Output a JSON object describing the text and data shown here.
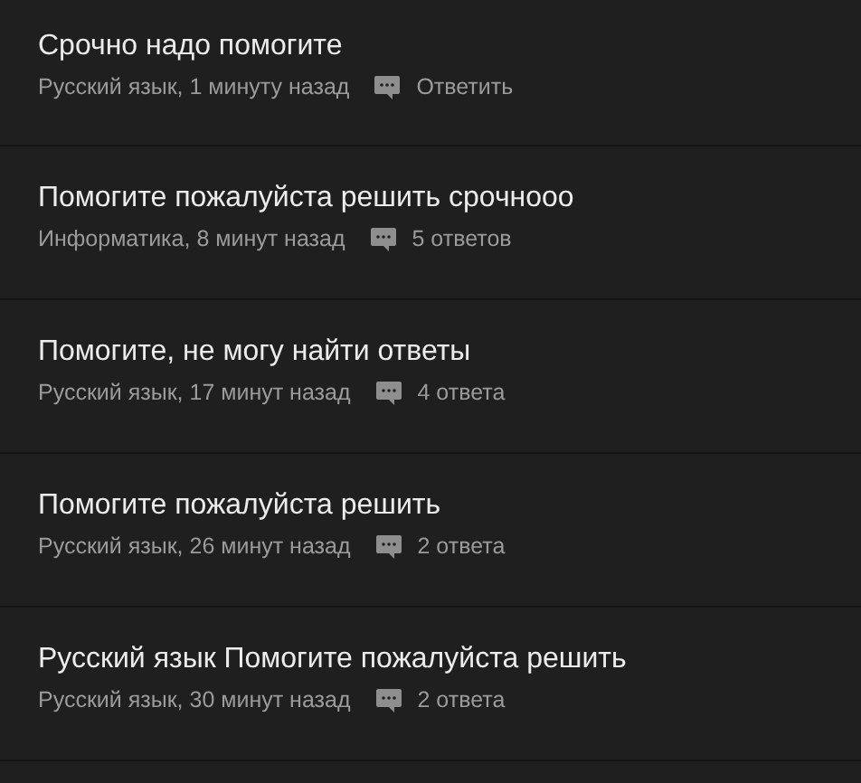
{
  "questions": [
    {
      "title": "Срочно надо помогите",
      "meta": "Русский язык, 1 минуту назад",
      "answers": "Ответить"
    },
    {
      "title": "Помогите пожалуйста решить срочнооо",
      "meta": "Информатика, 8 минут назад",
      "answers": "5 ответов"
    },
    {
      "title": "Помогите, не могу найти ответы",
      "meta": "Русский язык, 17 минут назад",
      "answers": "4 ответа"
    },
    {
      "title": "Помогите пожалуйста решить",
      "meta": "Русский язык, 26 минут назад",
      "answers": "2 ответа"
    },
    {
      "title": "Русский язык Помогите пожалуйста решить",
      "meta": "Русский язык, 30 минут назад",
      "answers": "2 ответа"
    }
  ]
}
